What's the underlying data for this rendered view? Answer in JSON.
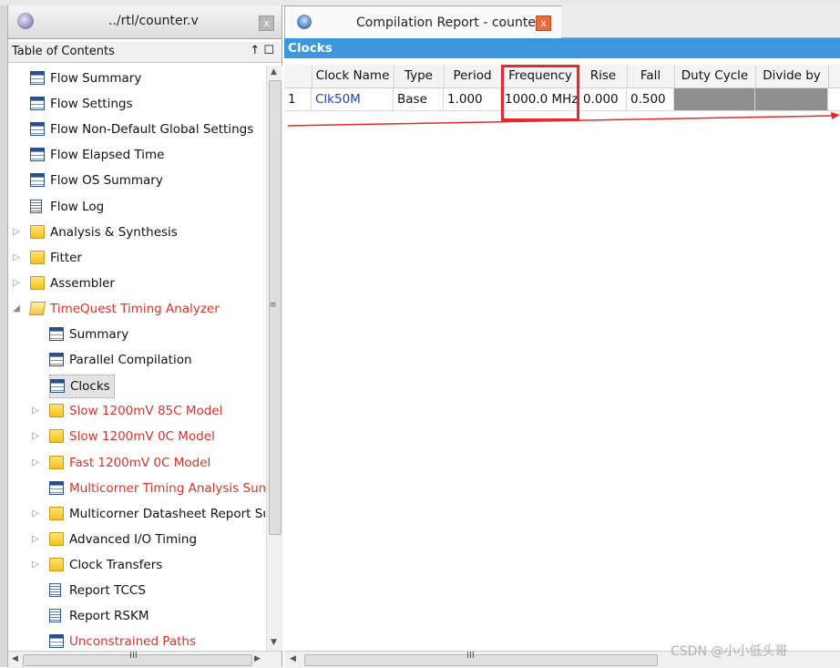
{
  "left_panel": {
    "file_tab_title": "../rtl/counter.v",
    "close_glyph": "x",
    "toc_title": "Table of Contents",
    "toc_pin_glyphs": "↑ ☐",
    "tree": [
      {
        "label": "Flow Summary",
        "icon": "table-icon",
        "indent": 0,
        "expander": "",
        "red": false
      },
      {
        "label": "Flow Settings",
        "icon": "table-icon",
        "indent": 0,
        "expander": "",
        "red": false
      },
      {
        "label": "Flow Non-Default Global Settings",
        "icon": "table-icon",
        "indent": 0,
        "expander": "",
        "red": false
      },
      {
        "label": "Flow Elapsed Time",
        "icon": "table-icon",
        "indent": 0,
        "expander": "",
        "red": false
      },
      {
        "label": "Flow OS Summary",
        "icon": "table-icon",
        "indent": 0,
        "expander": "",
        "red": false
      },
      {
        "label": "Flow Log",
        "icon": "document-icon",
        "indent": 0,
        "expander": "",
        "red": false
      },
      {
        "label": "Analysis & Synthesis",
        "icon": "folder-icon",
        "indent": 0,
        "expander": "collapsed",
        "red": false
      },
      {
        "label": "Fitter",
        "icon": "folder-icon",
        "indent": 0,
        "expander": "collapsed",
        "red": false
      },
      {
        "label": "Assembler",
        "icon": "folder-icon",
        "indent": 0,
        "expander": "collapsed",
        "red": false
      },
      {
        "label": "TimeQuest Timing Analyzer",
        "icon": "folder-open-icon",
        "indent": 0,
        "expander": "expanded",
        "red": true
      },
      {
        "label": "Summary",
        "icon": "table-icon",
        "indent": 1,
        "expander": "",
        "red": false
      },
      {
        "label": "Parallel Compilation",
        "icon": "table-icon",
        "indent": 1,
        "expander": "",
        "red": false
      },
      {
        "label": "Clocks",
        "icon": "table-icon",
        "indent": 1,
        "expander": "",
        "red": false,
        "selected": true
      },
      {
        "label": "Slow 1200mV 85C Model",
        "icon": "folder-icon",
        "indent": 1,
        "expander": "collapsed",
        "red": true
      },
      {
        "label": "Slow 1200mV 0C Model",
        "icon": "folder-icon",
        "indent": 1,
        "expander": "collapsed",
        "red": true
      },
      {
        "label": "Fast 1200mV 0C Model",
        "icon": "folder-icon",
        "indent": 1,
        "expander": "collapsed",
        "red": true
      },
      {
        "label": "Multicorner Timing Analysis Summary",
        "icon": "table-icon",
        "indent": 1,
        "expander": "",
        "red": true
      },
      {
        "label": "Multicorner Datasheet Report Summary",
        "icon": "folder-icon",
        "indent": 1,
        "expander": "collapsed",
        "red": false
      },
      {
        "label": "Advanced I/O Timing",
        "icon": "folder-icon",
        "indent": 1,
        "expander": "collapsed",
        "red": false
      },
      {
        "label": "Clock Transfers",
        "icon": "folder-icon",
        "indent": 1,
        "expander": "collapsed",
        "red": false
      },
      {
        "label": "Report TCCS",
        "icon": "document-icon",
        "indent": 1,
        "expander": "",
        "red": false
      },
      {
        "label": "Report RSKM",
        "icon": "document-icon",
        "indent": 1,
        "expander": "",
        "red": false
      },
      {
        "label": "Unconstrained Paths",
        "icon": "table-icon",
        "indent": 1,
        "expander": "",
        "red": true
      }
    ],
    "scroll_grip": "≡",
    "hscroll_grip": "III"
  },
  "report": {
    "tab_title": "Compilation Report - counter",
    "close_glyph": "x",
    "section_title": "Clocks",
    "columns": [
      "",
      "Clock Name",
      "Type",
      "Period",
      "Frequency",
      "Rise",
      "Fall",
      "Duty Cycle",
      "Divide by"
    ],
    "rows": [
      [
        "1",
        "Clk50M",
        "Base",
        "1.000",
        "1000.0 MHz",
        "0.000",
        "0.500",
        "",
        ""
      ]
    ],
    "hscroll_grip": "III"
  },
  "watermark": "CSDN @小小低头哥",
  "colors": {
    "accent_bar": "#3d97de",
    "red_text": "#e0302a",
    "highlight": "#e42a2a",
    "link": "#1f3fbf"
  }
}
